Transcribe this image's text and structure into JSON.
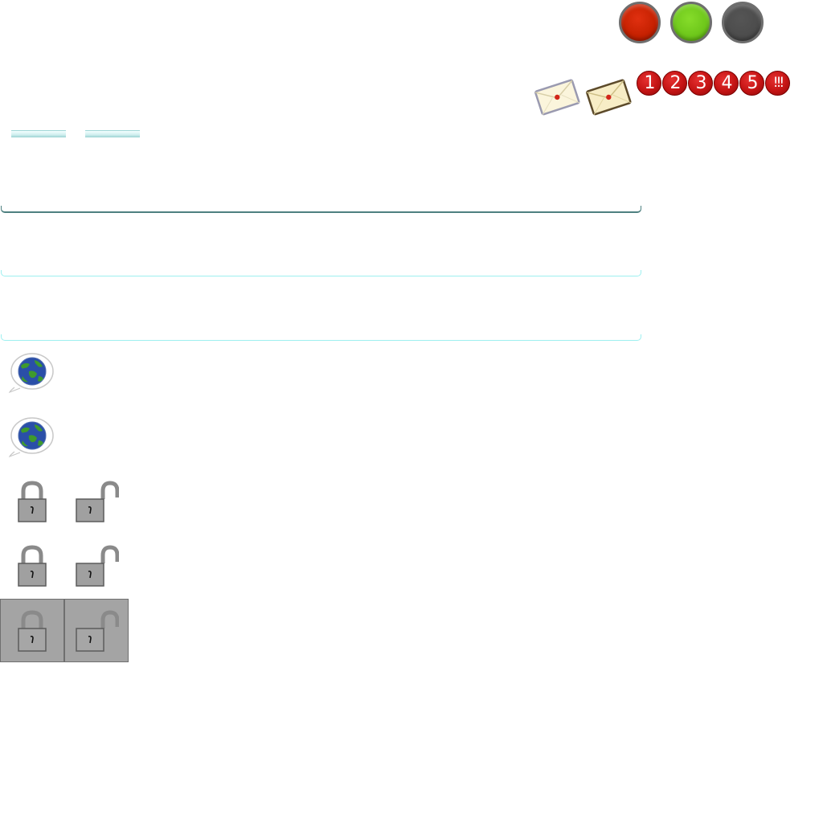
{
  "status_lights": [
    {
      "name": "red",
      "color": "#cc2200"
    },
    {
      "name": "green",
      "color": "#6dc61a"
    },
    {
      "name": "gray",
      "color": "#4c4c4c"
    }
  ],
  "envelopes": [
    {
      "state": "unread",
      "outline": "#9a9ab0"
    },
    {
      "state": "read",
      "outline": "#5c4a2a"
    }
  ],
  "badges": [
    "1",
    "2",
    "3",
    "4",
    "5",
    "!!!"
  ],
  "mini_tabs": [
    "tab-1",
    "tab-2"
  ],
  "bars": [
    {
      "name": "divider-dark",
      "color": "#4e8080"
    },
    {
      "name": "divider-light-1",
      "color": "#9ef0f0"
    },
    {
      "name": "divider-light-2",
      "color": "#9ef0f0"
    }
  ],
  "icons": {
    "globe": "globe-bubble-icon",
    "lock_closed": "lock-closed-icon",
    "lock_open": "lock-open-icon"
  },
  "colors": {
    "tile_bg": "#a4a4a4",
    "lock_body": "#a0a0a0"
  }
}
